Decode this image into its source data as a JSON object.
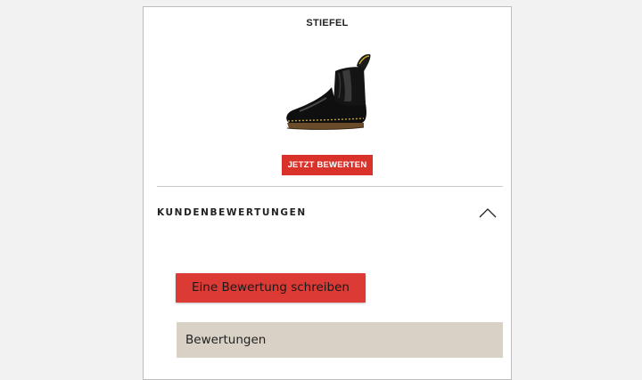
{
  "product": {
    "title": "STIEFEL",
    "image_icon": "chelsea-boot-image"
  },
  "rate_button": {
    "label": "JETZT BEWERTEN",
    "color": "#d9322b"
  },
  "reviews_section": {
    "header": "KUNDENBEWERTUNGEN",
    "expanded": true,
    "toggle_icon": "chevron-up-icon",
    "write_review_label": "Eine Bewertung schreiben",
    "write_review_color": "#dc3a35",
    "reviews_tab_label": "Bewertungen",
    "reviews_tab_color": "#d9d1c5"
  }
}
